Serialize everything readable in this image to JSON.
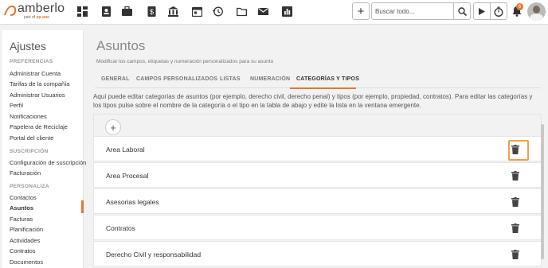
{
  "brand": {
    "name": "amberlo",
    "part_of": "part of",
    "partner": "ep-one",
    "accent_color": "#e6772e"
  },
  "topnav": {
    "icons": [
      "dashboard-icon",
      "contacts-icon",
      "briefcase-icon",
      "billing-icon",
      "bank-icon",
      "calendar-icon",
      "history-icon",
      "folder-icon",
      "mail-icon",
      "reports-icon"
    ],
    "search_placeholder": "Buscar todo...",
    "notification_count": "6"
  },
  "sidebar": {
    "title": "Ajustes",
    "sections": [
      {
        "label": "PREFERENCIAS",
        "items": [
          "Administrar Cuenta",
          "Tarifas de la compañía",
          "Administrar Usuarios",
          "Perfil",
          "Notificaciones",
          "Papelera de Reciclaje",
          "Portal del cliente"
        ]
      },
      {
        "label": "SUSCRIPCIÓN",
        "items": [
          "Configuración de suscripción",
          "Facturación"
        ]
      },
      {
        "label": "PERSONALIZA",
        "items": [
          "Contactos",
          "Asuntos",
          "Facturas",
          "Planificación",
          "Actividades",
          "Contratos",
          "Documentos"
        ]
      }
    ],
    "active_item": "Asuntos"
  },
  "main": {
    "title": "Asuntos",
    "subtitle": "Modificar los campos, etiquetas y numeración personalizados para su asunto",
    "tabs": [
      "GENERAL",
      "CAMPOS PERSONALIZADOS",
      "LISTAS",
      "NUMERACIÓN",
      "CATEGORÍAS Y TIPOS"
    ],
    "active_tab": "CATEGORÍAS Y TIPOS",
    "description": "Aquí puede editar categorías de asuntos (por ejemplo, derecho civil, derecho penal) y tipos (por ejemplo, propiedad, contratos). Para editar las categorías y los tipos pulse sobre el nombre de la categoría o el tipo en la tabla de abajo y edite la lista en la ventana emergente.",
    "add_label": "+",
    "categories": [
      "Area Laboral",
      "Area Procesal",
      "Asesorias legales",
      "Contratos",
      "Derecho Civil y responsabilidad"
    ]
  }
}
